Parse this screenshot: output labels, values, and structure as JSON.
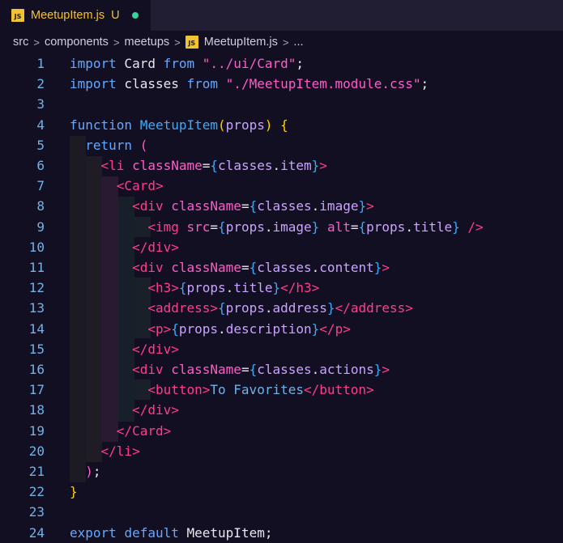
{
  "tab": {
    "icon": "JS",
    "filename": "MeetupItem.js",
    "status": "U"
  },
  "breadcrumb": {
    "parts": [
      "src",
      "components",
      "meetups"
    ],
    "file": "MeetupItem.js",
    "more": "..."
  },
  "code": {
    "line_numbers": [
      "1",
      "2",
      "3",
      "4",
      "5",
      "6",
      "7",
      "8",
      "9",
      "10",
      "11",
      "12",
      "13",
      "14",
      "15",
      "16",
      "17",
      "18",
      "19",
      "20",
      "21",
      "22",
      "23",
      "24"
    ],
    "lines": [
      [
        [
          "kw",
          "import"
        ],
        [
          "id",
          " Card "
        ],
        [
          "kw",
          "from"
        ],
        [
          "id",
          " "
        ],
        [
          "str",
          "\"../ui/Card\""
        ],
        [
          "pn",
          ";"
        ]
      ],
      [
        [
          "kw",
          "import"
        ],
        [
          "id",
          " classes "
        ],
        [
          "kw",
          "from"
        ],
        [
          "id",
          " "
        ],
        [
          "str",
          "\"./MeetupItem.module.css\""
        ],
        [
          "pn",
          ";"
        ]
      ],
      [],
      [
        [
          "kw",
          "function"
        ],
        [
          "id",
          " "
        ],
        [
          "fn",
          "MeetupItem"
        ],
        [
          "br1",
          "("
        ],
        [
          "prop",
          "props"
        ],
        [
          "br1",
          ")"
        ],
        [
          "id",
          " "
        ],
        [
          "br1",
          "{"
        ]
      ],
      [
        [
          "id",
          "  "
        ],
        [
          "kw",
          "return"
        ],
        [
          "id",
          " "
        ],
        [
          "br2",
          "("
        ]
      ],
      [
        [
          "id",
          "    "
        ],
        [
          "tag",
          "<li "
        ],
        [
          "attr",
          "className"
        ],
        [
          "pn",
          "="
        ],
        [
          "br3",
          "{"
        ],
        [
          "prop",
          "classes"
        ],
        [
          "pn",
          "."
        ],
        [
          "prop",
          "item"
        ],
        [
          "br3",
          "}"
        ],
        [
          "tag",
          ">"
        ]
      ],
      [
        [
          "id",
          "      "
        ],
        [
          "tag",
          "<Card>"
        ]
      ],
      [
        [
          "id",
          "        "
        ],
        [
          "tag",
          "<div "
        ],
        [
          "attr",
          "className"
        ],
        [
          "pn",
          "="
        ],
        [
          "br3",
          "{"
        ],
        [
          "prop",
          "classes"
        ],
        [
          "pn",
          "."
        ],
        [
          "prop",
          "image"
        ],
        [
          "br3",
          "}"
        ],
        [
          "tag",
          ">"
        ]
      ],
      [
        [
          "id",
          "          "
        ],
        [
          "tag",
          "<img "
        ],
        [
          "attr",
          "src"
        ],
        [
          "pn",
          "="
        ],
        [
          "br3",
          "{"
        ],
        [
          "prop",
          "props"
        ],
        [
          "pn",
          "."
        ],
        [
          "prop",
          "image"
        ],
        [
          "br3",
          "}"
        ],
        [
          "id",
          " "
        ],
        [
          "attr",
          "alt"
        ],
        [
          "pn",
          "="
        ],
        [
          "br3",
          "{"
        ],
        [
          "prop",
          "props"
        ],
        [
          "pn",
          "."
        ],
        [
          "prop",
          "title"
        ],
        [
          "br3",
          "}"
        ],
        [
          "id",
          " "
        ],
        [
          "tag",
          "/>"
        ]
      ],
      [
        [
          "id",
          "        "
        ],
        [
          "tag",
          "</div>"
        ]
      ],
      [
        [
          "id",
          "        "
        ],
        [
          "tag",
          "<div "
        ],
        [
          "attr",
          "className"
        ],
        [
          "pn",
          "="
        ],
        [
          "br3",
          "{"
        ],
        [
          "prop",
          "classes"
        ],
        [
          "pn",
          "."
        ],
        [
          "prop",
          "content"
        ],
        [
          "br3",
          "}"
        ],
        [
          "tag",
          ">"
        ]
      ],
      [
        [
          "id",
          "          "
        ],
        [
          "tag",
          "<h3>"
        ],
        [
          "br3",
          "{"
        ],
        [
          "prop",
          "props"
        ],
        [
          "pn",
          "."
        ],
        [
          "prop",
          "title"
        ],
        [
          "br3",
          "}"
        ],
        [
          "tag",
          "</h3>"
        ]
      ],
      [
        [
          "id",
          "          "
        ],
        [
          "tag",
          "<address>"
        ],
        [
          "br3",
          "{"
        ],
        [
          "prop",
          "props"
        ],
        [
          "pn",
          "."
        ],
        [
          "prop",
          "address"
        ],
        [
          "br3",
          "}"
        ],
        [
          "tag",
          "</address>"
        ]
      ],
      [
        [
          "id",
          "          "
        ],
        [
          "tag",
          "<p>"
        ],
        [
          "br3",
          "{"
        ],
        [
          "prop",
          "props"
        ],
        [
          "pn",
          "."
        ],
        [
          "prop",
          "description"
        ],
        [
          "br3",
          "}"
        ],
        [
          "tag",
          "</p>"
        ]
      ],
      [
        [
          "id",
          "        "
        ],
        [
          "tag",
          "</div>"
        ]
      ],
      [
        [
          "id",
          "        "
        ],
        [
          "tag",
          "<div "
        ],
        [
          "attr",
          "className"
        ],
        [
          "pn",
          "="
        ],
        [
          "br3",
          "{"
        ],
        [
          "prop",
          "classes"
        ],
        [
          "pn",
          "."
        ],
        [
          "prop",
          "actions"
        ],
        [
          "br3",
          "}"
        ],
        [
          "tag",
          ">"
        ]
      ],
      [
        [
          "id",
          "          "
        ],
        [
          "tag",
          "<button>"
        ],
        [
          "txt",
          "To Favorites"
        ],
        [
          "tag",
          "</button>"
        ]
      ],
      [
        [
          "id",
          "        "
        ],
        [
          "tag",
          "</div>"
        ]
      ],
      [
        [
          "id",
          "      "
        ],
        [
          "tag",
          "</Card>"
        ]
      ],
      [
        [
          "id",
          "    "
        ],
        [
          "tag",
          "</li>"
        ]
      ],
      [
        [
          "id",
          "  "
        ],
        [
          "br2",
          ")"
        ],
        [
          "pn",
          ";"
        ]
      ],
      [
        [
          "br1",
          "}"
        ]
      ],
      [],
      [
        [
          "kw",
          "export"
        ],
        [
          "id",
          " "
        ],
        [
          "kw",
          "default"
        ],
        [
          "id",
          " MeetupItem"
        ],
        [
          "pn",
          ";"
        ]
      ]
    ]
  }
}
